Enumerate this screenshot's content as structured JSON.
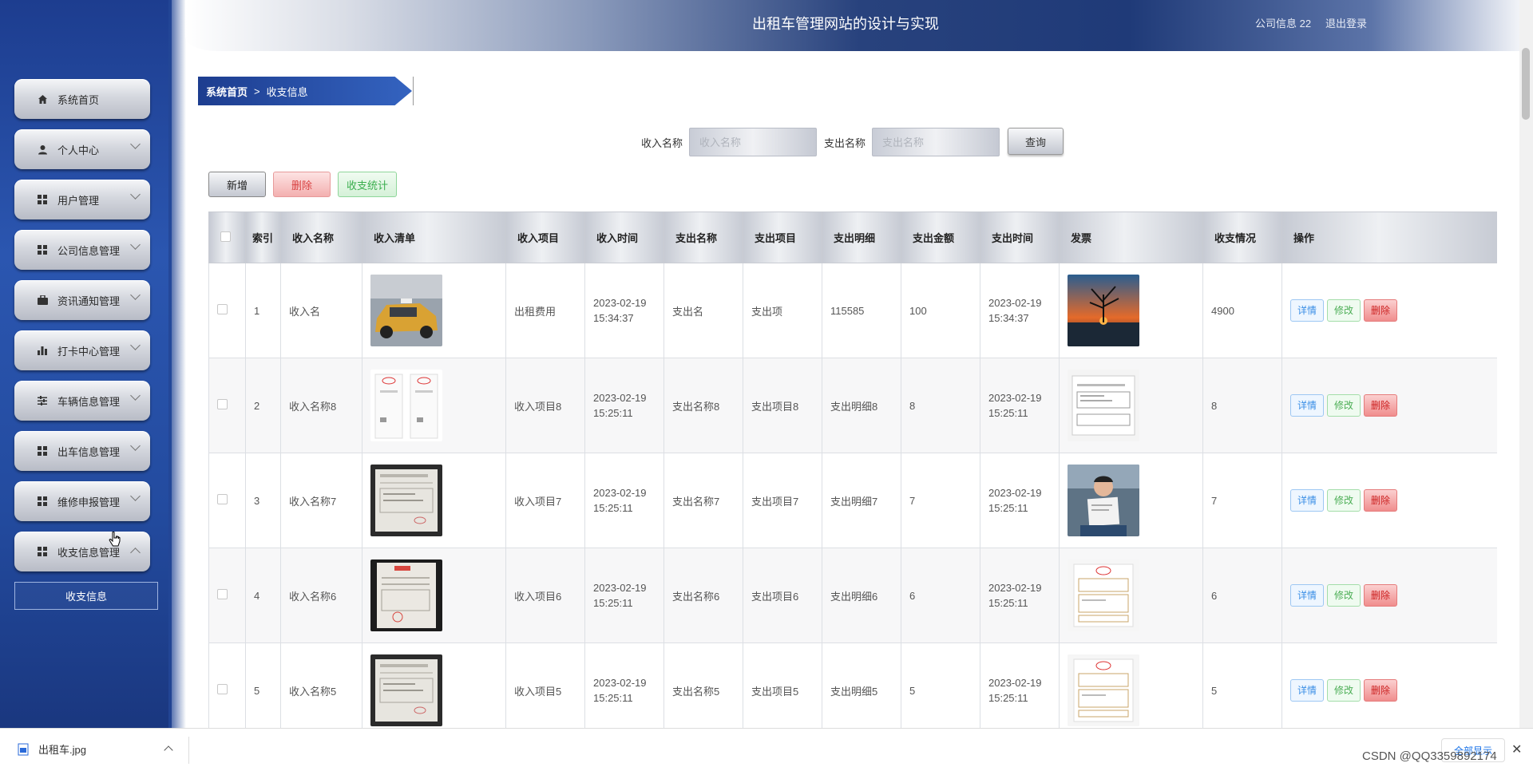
{
  "header": {
    "title": "出租车管理网站的设计与实现",
    "user_label": "公司信息 22",
    "logout_label": "退出登录"
  },
  "sidebar": {
    "items": [
      {
        "label": "系统首页",
        "icon": "home-icon",
        "expandable": false
      },
      {
        "label": "个人中心",
        "icon": "user-icon",
        "expandable": true
      },
      {
        "label": "用户管理",
        "icon": "grid-icon",
        "expandable": true
      },
      {
        "label": "公司信息管理",
        "icon": "grid-icon",
        "expandable": true
      },
      {
        "label": "资讯通知管理",
        "icon": "briefcase-icon",
        "expandable": true
      },
      {
        "label": "打卡中心管理",
        "icon": "bar-chart-icon",
        "expandable": true
      },
      {
        "label": "车辆信息管理",
        "icon": "sliders-icon",
        "expandable": true
      },
      {
        "label": "出车信息管理",
        "icon": "grid-icon",
        "expandable": true
      },
      {
        "label": "维修申报管理",
        "icon": "grid-icon",
        "expandable": true
      },
      {
        "label": "收支信息管理",
        "icon": "grid-icon",
        "expandable": true,
        "expanded": true
      }
    ],
    "sub_item": "收支信息"
  },
  "breadcrumb": {
    "home": "系统首页",
    "separator": ">",
    "current": "收支信息"
  },
  "search": {
    "income_label": "收入名称",
    "income_placeholder": "收入名称",
    "expense_label": "支出名称",
    "expense_placeholder": "支出名称",
    "query_button": "查询"
  },
  "actions": {
    "add": "新增",
    "delete": "删除",
    "stats": "收支统计"
  },
  "table": {
    "columns": [
      "",
      "索引",
      "收入名称",
      "收入清单",
      "收入项目",
      "收入时间",
      "支出名称",
      "支出项目",
      "支出明细",
      "支出金额",
      "支出时间",
      "发票",
      "收支情况",
      "操作"
    ],
    "rows": [
      {
        "index": "1",
        "income_name": "收入名",
        "income_list_img": "taxi-photo",
        "income_item": "出租费用",
        "income_date": "2023-02-19",
        "income_time": "15:34:37",
        "expense_name": "支出名",
        "expense_item": "支出项",
        "expense_detail": "115585",
        "expense_amount": "100",
        "expense_date": "2023-02-19",
        "expense_time": "15:34:37",
        "invoice_img": "sunset-tree-photo",
        "balance": "4900"
      },
      {
        "index": "2",
        "income_name": "收入名称8",
        "income_list_img": "receipt-pair",
        "income_item": "收入项目8",
        "income_date": "2023-02-19",
        "income_time": "15:25:11",
        "expense_name": "支出名称8",
        "expense_item": "支出项目8",
        "expense_detail": "支出明细8",
        "expense_amount": "8",
        "expense_date": "2023-02-19",
        "expense_time": "15:25:11",
        "invoice_img": "invoice-doc",
        "balance": "8"
      },
      {
        "index": "3",
        "income_name": "收入名称7",
        "income_list_img": "receipt-photo",
        "income_item": "收入项目7",
        "income_date": "2023-02-19",
        "income_time": "15:25:11",
        "expense_name": "支出名称7",
        "expense_item": "支出项目7",
        "expense_detail": "支出明细7",
        "expense_amount": "7",
        "expense_date": "2023-02-19",
        "expense_time": "15:25:11",
        "invoice_img": "person-holding-paper",
        "balance": "7"
      },
      {
        "index": "4",
        "income_name": "收入名称6",
        "income_list_img": "receipt-red-stamp",
        "income_item": "收入项目6",
        "income_date": "2023-02-19",
        "income_time": "15:25:11",
        "expense_name": "支出名称6",
        "expense_item": "支出项目6",
        "expense_detail": "支出明细6",
        "expense_amount": "6",
        "expense_date": "2023-02-19",
        "expense_time": "15:25:11",
        "invoice_img": "invoice-red",
        "balance": "6"
      },
      {
        "index": "5",
        "income_name": "收入名称5",
        "income_list_img": "receipt-photo",
        "income_item": "收入项目5",
        "income_date": "2023-02-19",
        "income_time": "15:25:11",
        "expense_name": "支出名称5",
        "expense_item": "支出项目5",
        "expense_detail": "支出明细5",
        "expense_amount": "5",
        "expense_date": "2023-02-19",
        "expense_time": "15:25:11",
        "invoice_img": "invoice-red",
        "balance": "5"
      }
    ],
    "op_detail": "详情",
    "op_edit": "修改",
    "op_delete": "删除"
  },
  "download_bar": {
    "file_name": "出租车.jpg",
    "show_all": "全部显示",
    "close": "✕"
  },
  "watermark": "CSDN @QQ3359892174",
  "colors": {
    "sidebar": "#2b56b0",
    "header_dark": "#1f3a78",
    "detail": "#3a8ee6",
    "edit": "#4cae55",
    "delete": "#d94242"
  }
}
